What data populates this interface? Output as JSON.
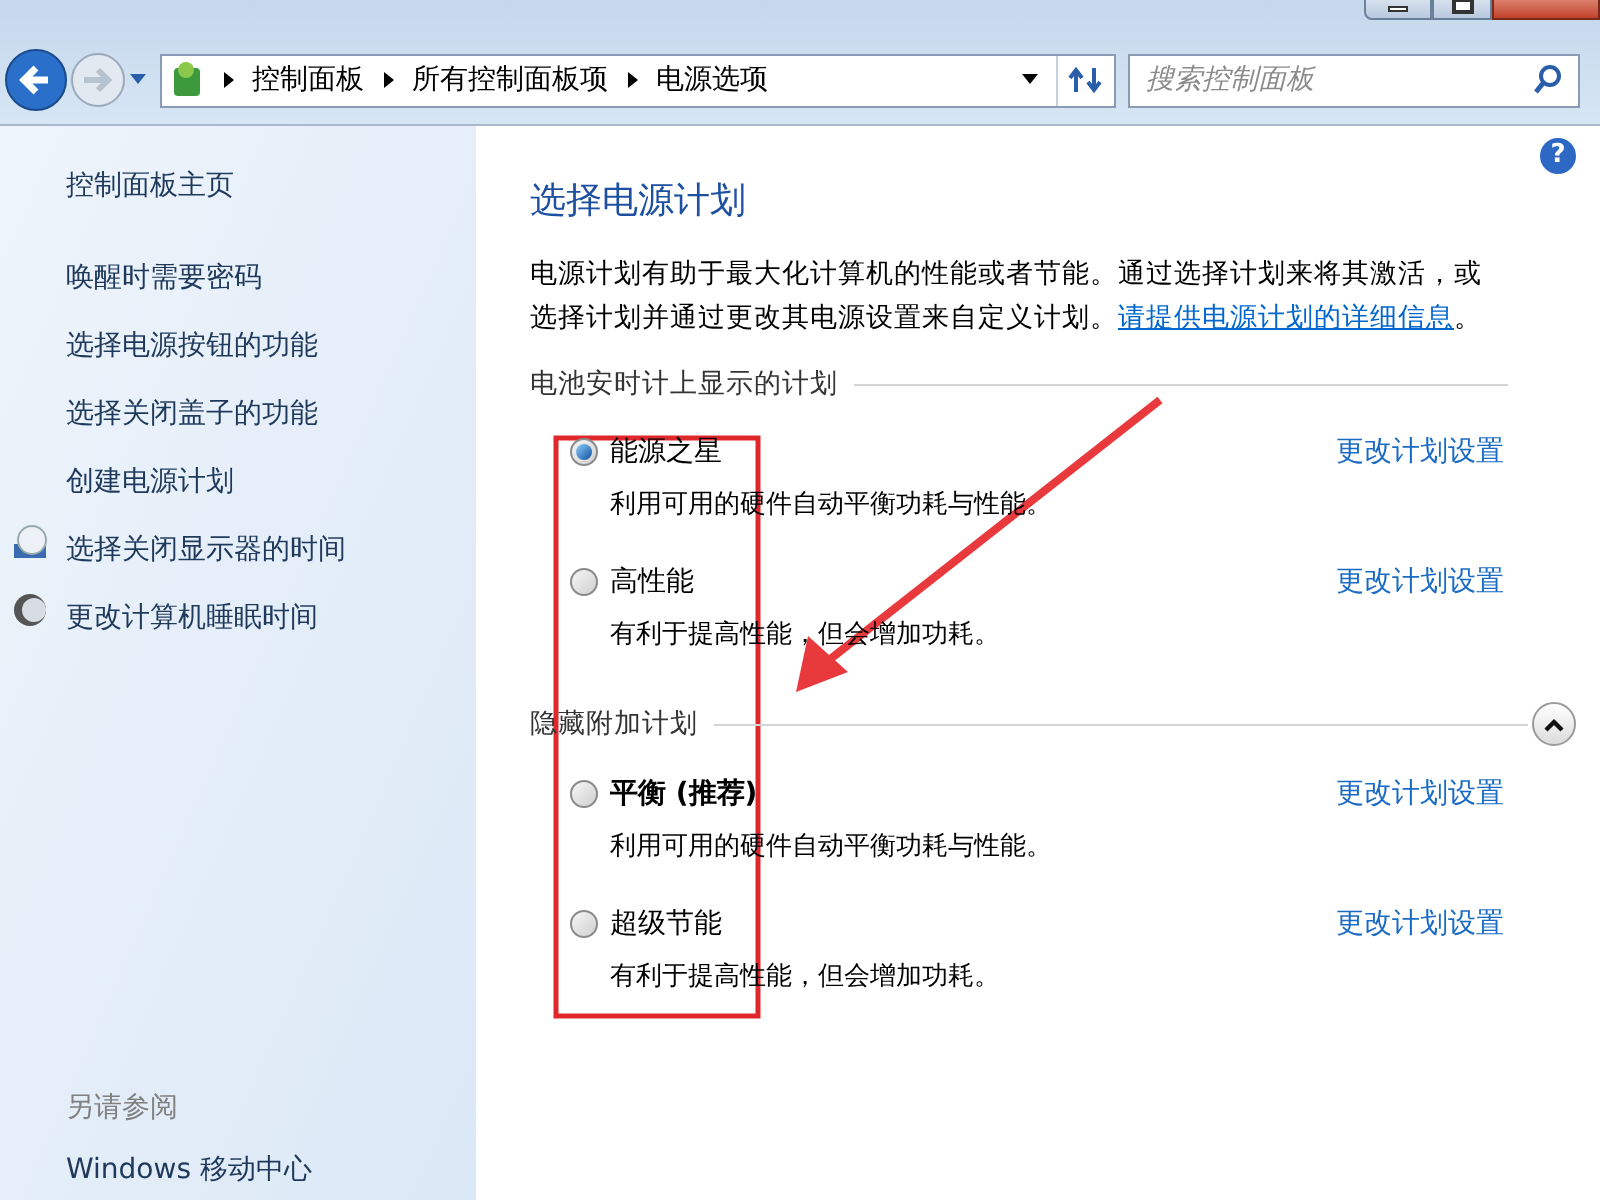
{
  "address_bar": {
    "breadcrumbs": [
      "控制面板",
      "所有控制面板项",
      "电源选项"
    ],
    "search": {
      "placeholder": "搜索控制面板"
    }
  },
  "sidebar": {
    "home": "控制面板主页",
    "items": [
      {
        "label": "唤醒时需要密码",
        "kind": "plain"
      },
      {
        "label": "选择电源按钮的功能",
        "kind": "plain"
      },
      {
        "label": "选择关闭盖子的功能",
        "kind": "plain"
      },
      {
        "label": "创建电源计划",
        "kind": "plain"
      },
      {
        "label": "选择关闭显示器的时间",
        "kind": "display"
      },
      {
        "label": "更改计算机睡眠时间",
        "kind": "sleep"
      }
    ],
    "see_also": {
      "heading": "另请参阅",
      "items": [
        "Windows 移动中心"
      ]
    }
  },
  "main": {
    "help": "?",
    "title": "选择电源计划",
    "intro": "电源计划有助于最大化计算机的性能或者节能。通过选择计划来将其激活，或选择计划并通过更改其电源设置来自定义计划。",
    "intro_link": "请提供电源计划的详细信息",
    "intro_end": "。",
    "sections": [
      {
        "heading": "电池安时计上显示的计划",
        "plans": [
          {
            "name": "能源之星",
            "emphasized": false,
            "description": "利用可用的硬件自动平衡功耗与性能。",
            "selected": true,
            "link": "更改计划设置"
          },
          {
            "name": "高性能",
            "emphasized": false,
            "description": "有利于提高性能，但会增加功耗。",
            "selected": false,
            "link": "更改计划设置"
          }
        ]
      },
      {
        "heading": "隐藏附加计划",
        "expanded": true,
        "plans": [
          {
            "name": "平衡 (推荐)",
            "emphasized": true,
            "description": "利用可用的硬件自动平衡功耗与性能。",
            "selected": false,
            "link": "更改计划设置"
          },
          {
            "name": "超级节能",
            "emphasized": false,
            "description": "有利于提高性能，但会增加功耗。",
            "selected": false,
            "link": "更改计划设置"
          }
        ]
      }
    ]
  }
}
